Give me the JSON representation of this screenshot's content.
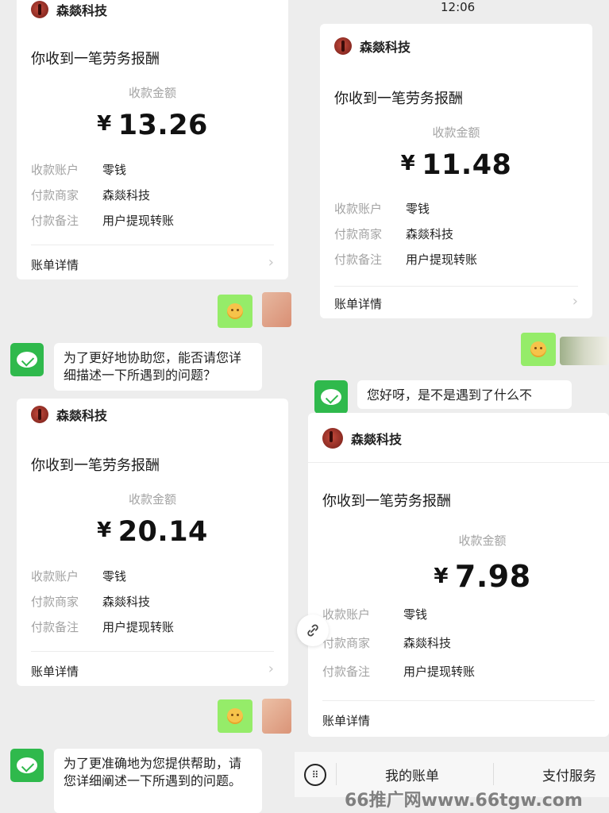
{
  "status_time": "12:06",
  "merchant": "森燚科技",
  "cards": [
    {
      "title": "你收到一笔劳务报酬",
      "amount_label": "收款金额",
      "currency": "¥",
      "amount": "13.26",
      "fields": [
        {
          "key": "收款账户",
          "value": "零钱"
        },
        {
          "key": "付款商家",
          "value": "森燚科技"
        },
        {
          "key": "付款备注",
          "value": "用户提现转账"
        }
      ],
      "detail_label": "账单详情"
    },
    {
      "title": "你收到一笔劳务报酬",
      "amount_label": "收款金额",
      "currency": "¥",
      "amount": "11.48",
      "fields": [
        {
          "key": "收款账户",
          "value": "零钱"
        },
        {
          "key": "付款商家",
          "value": "森燚科技"
        },
        {
          "key": "付款备注",
          "value": "用户提现转账"
        }
      ],
      "detail_label": "账单详情"
    },
    {
      "title": "你收到一笔劳务报酬",
      "amount_label": "收款金额",
      "currency": "¥",
      "amount": "20.14",
      "fields": [
        {
          "key": "收款账户",
          "value": "零钱"
        },
        {
          "key": "付款商家",
          "value": "森燚科技"
        },
        {
          "key": "付款备注",
          "value": "用户提现转账"
        }
      ],
      "detail_label": "账单详情"
    },
    {
      "title": "你收到一笔劳务报酬",
      "amount_label": "收款金额",
      "currency": "¥",
      "amount": "7.98",
      "fields": [
        {
          "key": "收款账户",
          "value": "零钱"
        },
        {
          "key": "付款商家",
          "value": "森燚科技"
        },
        {
          "key": "付款备注",
          "value": "用户提现转账"
        }
      ],
      "detail_label": "账单详情"
    }
  ],
  "replies": {
    "top_left": "为了更好地协助您，能否请您详细描述一下所遇到的问题？",
    "top_right": "您好呀，是不是遇到了什么不",
    "bottom_left": "为了更准确地为您提供帮助，请您详细阐述一下所遇到的问题。"
  },
  "bottom_bar": {
    "my_bills": "我的账单",
    "pay_service": "支付服务"
  },
  "watermark": "66推广网www.66tgw.com",
  "icons": {
    "keyboard": "keyboard-icon",
    "link": "link-icon",
    "chevron": "chevron-right-icon",
    "wechat_pay": "wechat-pay-icon"
  }
}
